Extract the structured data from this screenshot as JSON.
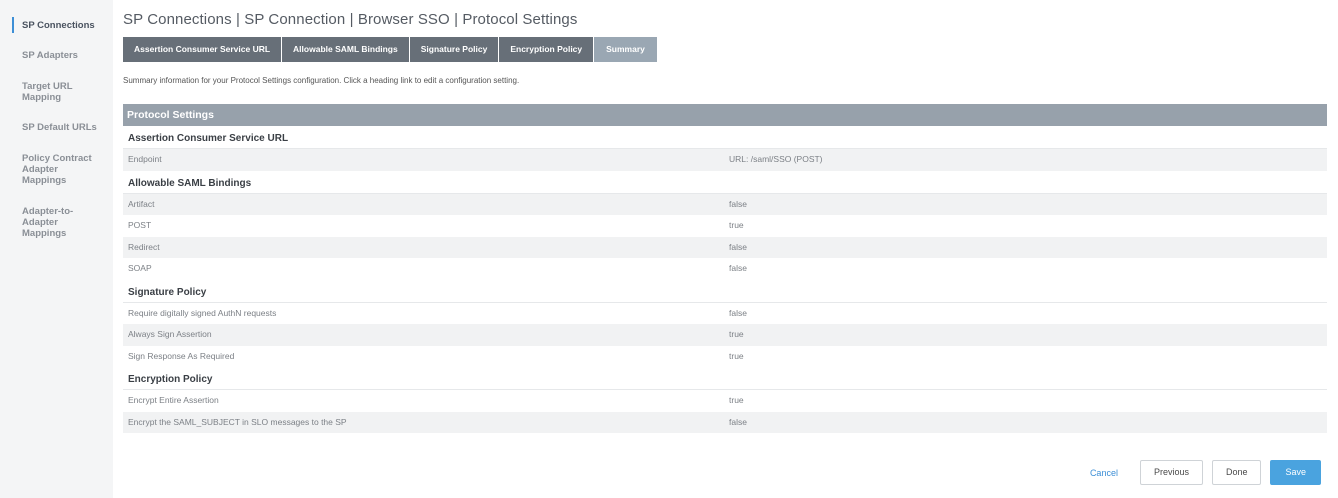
{
  "sidebar": {
    "items": [
      {
        "label": "SP Connections"
      },
      {
        "label": "SP Adapters"
      },
      {
        "label": "Target URL Mapping"
      },
      {
        "label": "SP Default URLs"
      },
      {
        "label": "Policy Contract Adapter Mappings"
      },
      {
        "label": "Adapter-to-Adapter Mappings"
      }
    ]
  },
  "header": {
    "title": "SP Connections | SP Connection | Browser SSO | Protocol Settings"
  },
  "tabs": [
    {
      "label": "Assertion Consumer Service URL"
    },
    {
      "label": "Allowable SAML Bindings"
    },
    {
      "label": "Signature Policy"
    },
    {
      "label": "Encryption Policy"
    },
    {
      "label": "Summary"
    }
  ],
  "intro": "Summary information for your Protocol Settings configuration. Click a heading link to edit a configuration setting.",
  "summary": {
    "title": "Protocol Settings",
    "groups": [
      {
        "heading": "Assertion Consumer Service URL",
        "rows": [
          {
            "label": "Endpoint",
            "value": "URL: /saml/SSO (POST)"
          }
        ]
      },
      {
        "heading": "Allowable SAML Bindings",
        "rows": [
          {
            "label": "Artifact",
            "value": "false"
          },
          {
            "label": "POST",
            "value": "true"
          },
          {
            "label": "Redirect",
            "value": "false"
          },
          {
            "label": "SOAP",
            "value": "false"
          }
        ]
      },
      {
        "heading": "Signature Policy",
        "rows": [
          {
            "label": "Require digitally signed AuthN requests",
            "value": "false"
          },
          {
            "label": "Always Sign Assertion",
            "value": "true"
          },
          {
            "label": "Sign Response As Required",
            "value": "true"
          }
        ]
      },
      {
        "heading": "Encryption Policy",
        "rows": [
          {
            "label": "Encrypt Entire Assertion",
            "value": "true"
          },
          {
            "label": "Encrypt the SAML_SUBJECT in SLO messages to the SP",
            "value": "false"
          }
        ]
      }
    ]
  },
  "footer": {
    "cancel": "Cancel",
    "previous": "Previous",
    "done": "Done",
    "save": "Save"
  },
  "colors": {
    "accent": "#3d8fd6",
    "tab_bg": "#676f78",
    "tab_active_bg": "#9aa7b3",
    "section_header_bg": "#97a1ab",
    "save_bg": "#4aa3df"
  }
}
